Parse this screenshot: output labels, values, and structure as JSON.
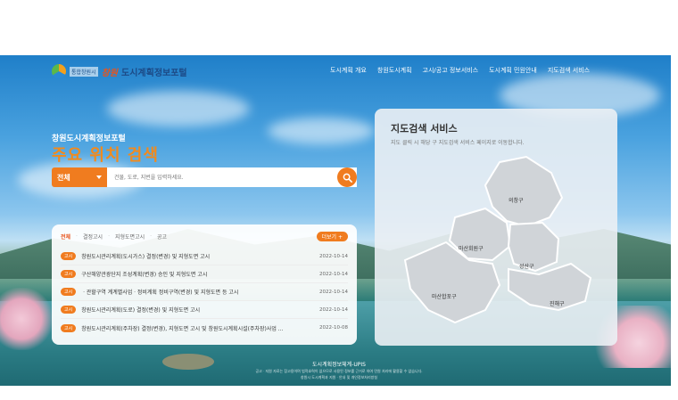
{
  "header": {
    "logo_sub": "통합창원시",
    "logo_city": "창원",
    "logo_main": "도시계획정보포털",
    "nav": [
      "도시계획 개요",
      "창원도시계획",
      "고시/공고 정보서비스",
      "도시계획 민원안내",
      "지도검색 서비스"
    ]
  },
  "hero": {
    "subtitle": "창원도시계획정보포털",
    "title": "주요 위치 검색"
  },
  "search": {
    "select_value": "전체",
    "placeholder": "건물, 도로, 지번을 입력하세요."
  },
  "notice": {
    "tabs": [
      "전체",
      "결정고시",
      "지형도면고시",
      "공고"
    ],
    "more_label": "더보기",
    "rows": [
      {
        "badge": "고시",
        "title": "창원도시관리계획(도시가스) 결정(변경) 및 지형도면 고시",
        "date": "2022-10-14"
      },
      {
        "badge": "고시",
        "title": "구산해양관광단지 조성계획(변경) 승인 및 지형도면 고시",
        "date": "2022-10-14"
      },
      {
        "badge": "고시",
        "title": "ㆍ관할구역 계계별사업ㆍ정비계획 정비구역(변경) 및 지형도면 등 고시",
        "date": "2022-10-14"
      },
      {
        "badge": "고시",
        "title": "창원도시관리계획(도로) 결정(변경) 및 지형도면 고시",
        "date": "2022-10-14"
      },
      {
        "badge": "고시",
        "title": "창원도시관리계획(주차장) 결정(변경), 지형도면 고시 및 창원도시계획시설(주차장)사업 ...",
        "date": "2022-10-08"
      }
    ]
  },
  "map": {
    "title": "지도검색 서비스",
    "desc": "지도 클릭 시 해당 구 지도검색 서비스 페이지로 이동합니다.",
    "districts": [
      "의창구",
      "마산회원구",
      "성산구",
      "마산합포구",
      "진해구"
    ]
  },
  "footer": {
    "title": "도시계획정보체계-UPIS",
    "line1": "공고ㆍ지원 자료는 참고용이며 법적효력이 없으므로 사용된 정보를 근거로 하여 민원 처리에 활용할 수 없습니다.",
    "line2": "창원시 도시계획과 지원ㆍ안내 및 개인정보처리방침"
  },
  "colors": {
    "accent": "#f07c1f",
    "nav_text": "#ffffff",
    "map_fill": "#d0d4d8"
  }
}
